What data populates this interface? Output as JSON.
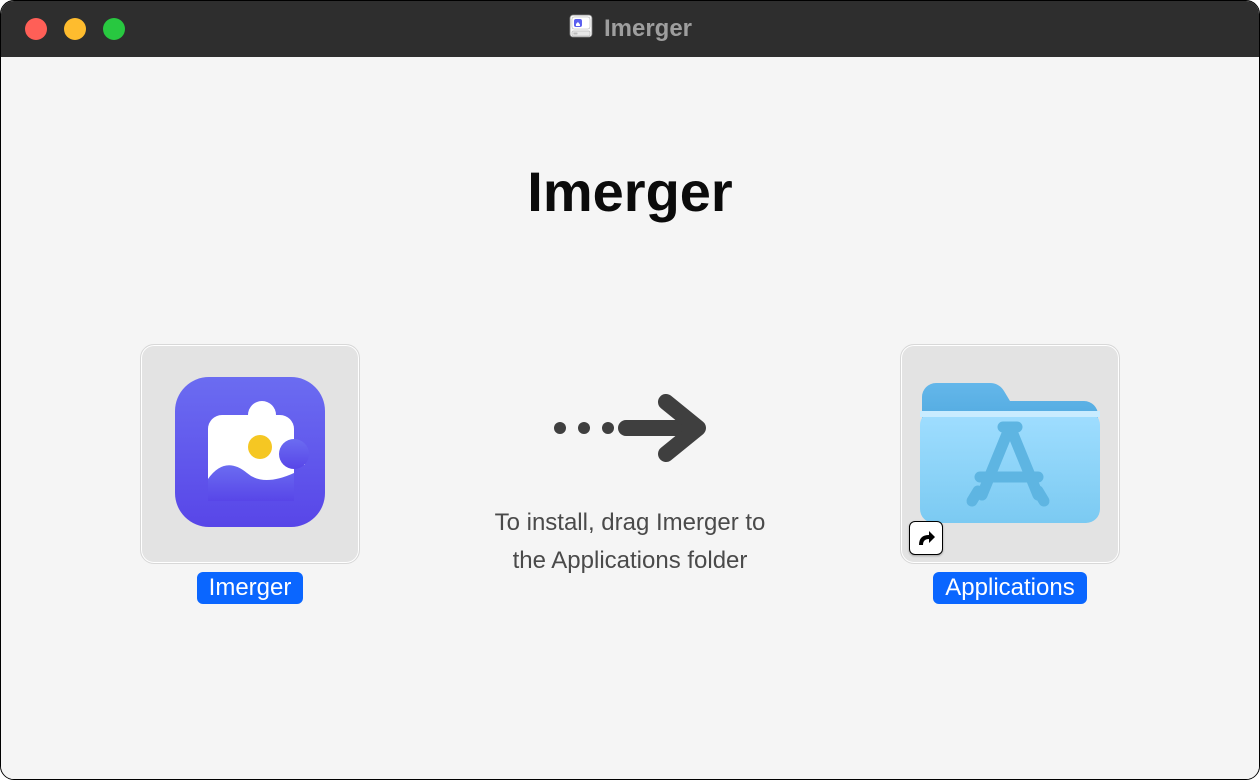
{
  "window": {
    "title": "Imerger"
  },
  "heading": "Imerger",
  "instruction": "To install, drag Imerger to the Applications folder",
  "app": {
    "label": "Imerger"
  },
  "destination": {
    "label": "Applications"
  }
}
